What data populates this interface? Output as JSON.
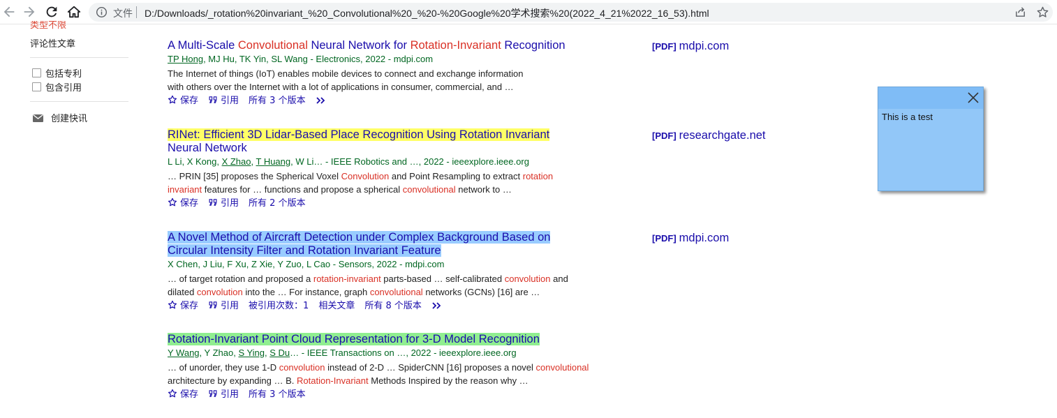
{
  "browser": {
    "file_label": "文件",
    "url": "D:/Downloads/_rotation%20invariant_%20_Convolutional%20_%20-%20Google%20学术搜索%20(2022_4_21%2022_16_53).html"
  },
  "sidebar": {
    "type_any": "类型不限",
    "review_articles": "评论性文章",
    "include_patents": "包括专利",
    "include_citations": "包含引用",
    "create_alert": "创建快讯"
  },
  "actions": {
    "save": "保存",
    "cite": "引用",
    "cited_by": "被引用次数：1",
    "related": "相关文章"
  },
  "results": [
    {
      "title_parts": [
        "A Multi-Scale ",
        "Convolutional",
        " Neural Network for ",
        "Rotation-Invariant",
        " Recognition"
      ],
      "authors_linked": "TP Hong",
      "authors_rest": ", MJ Hu, TK Yin, SL Wang - Electronics, 2022 - mdpi.com",
      "snippet_line1": "The Internet of things (IoT) enables mobile devices to connect and exchange information",
      "snippet_line2": "with others over the Internet with a lot of applications in consumer, commercial, and …",
      "versions": "所有 3 个版本",
      "pdf_tag": "[PDF]",
      "pdf_source": "mdpi.com"
    },
    {
      "title_line1": "RINet: Efficient 3D Lidar-Based Place Recognition Using Rotation Invariant",
      "title_line2": "Neural Network",
      "authors_a": "L Li, X Kong, ",
      "authors_b": "X Zhao",
      "authors_c": ", ",
      "authors_d": "T Huang",
      "authors_e": ", W Li… - IEEE Robotics and …, 2022 - ieeexplore.ieee.org",
      "snippet_parts_1": [
        "… PRIN [35] proposes the Spherical Voxel ",
        "Convolution",
        " and Point Resampling to extract ",
        "rotation"
      ],
      "snippet_parts_2": [
        "invariant",
        " features for … functions and propose a spherical ",
        "convolutional",
        " network to …"
      ],
      "versions": "所有 2 个版本",
      "pdf_tag": "[PDF]",
      "pdf_source": "researchgate.net"
    },
    {
      "title_line1": "A Novel Method of Aircraft Detection under Complex Background Based on",
      "title_line2": "Circular Intensity Filter and Rotation Invariant Feature",
      "authors": "X Chen, J Liu, F Xu, Z Xie, Y Zuo, L Cao - Sensors, 2022 - mdpi.com",
      "snippet_parts_1": [
        "… of target rotation and proposed a ",
        "rotation-invariant",
        " parts-based … self-calibrated ",
        "convolution",
        " and"
      ],
      "snippet_parts_2": [
        "dilated ",
        "convolution",
        " into the … For instance, graph ",
        "convolutional",
        " networks (GCNs) [16] are …"
      ],
      "versions": "所有 8 个版本",
      "pdf_tag": "[PDF]",
      "pdf_source": "mdpi.com"
    },
    {
      "title": "Rotation-Invariant Point Cloud Representation for 3-D Model Recognition",
      "authors_a": "Y Wang",
      "authors_b": ", Y Zhao, ",
      "authors_c": "S Ying",
      "authors_d": ", ",
      "authors_e": "S Du",
      "authors_f": "… - IEEE Transactions on …, 2022 - ieeexplore.ieee.org",
      "snippet_parts_1": [
        "… of unorder, they use 1-D ",
        "convolution",
        " instead of 2-D … SpiderCNN [16] proposes a novel ",
        "convolutional"
      ],
      "snippet_parts_2": [
        "architecture by expanding … B. ",
        "Rotation-Invariant",
        " Methods Inspired by the reason why …"
      ],
      "versions": "所有 3 个版本"
    }
  ],
  "popup": {
    "text": "This is a test"
  },
  "colors": {
    "link": "#1a0dab",
    "keyword": "#d93025",
    "meta_green": "#006621",
    "highlight_yellow": "#ffff66",
    "highlight_blue": "#99ccff",
    "highlight_green": "#90ee90",
    "popup_bg": "#92c7f8"
  }
}
